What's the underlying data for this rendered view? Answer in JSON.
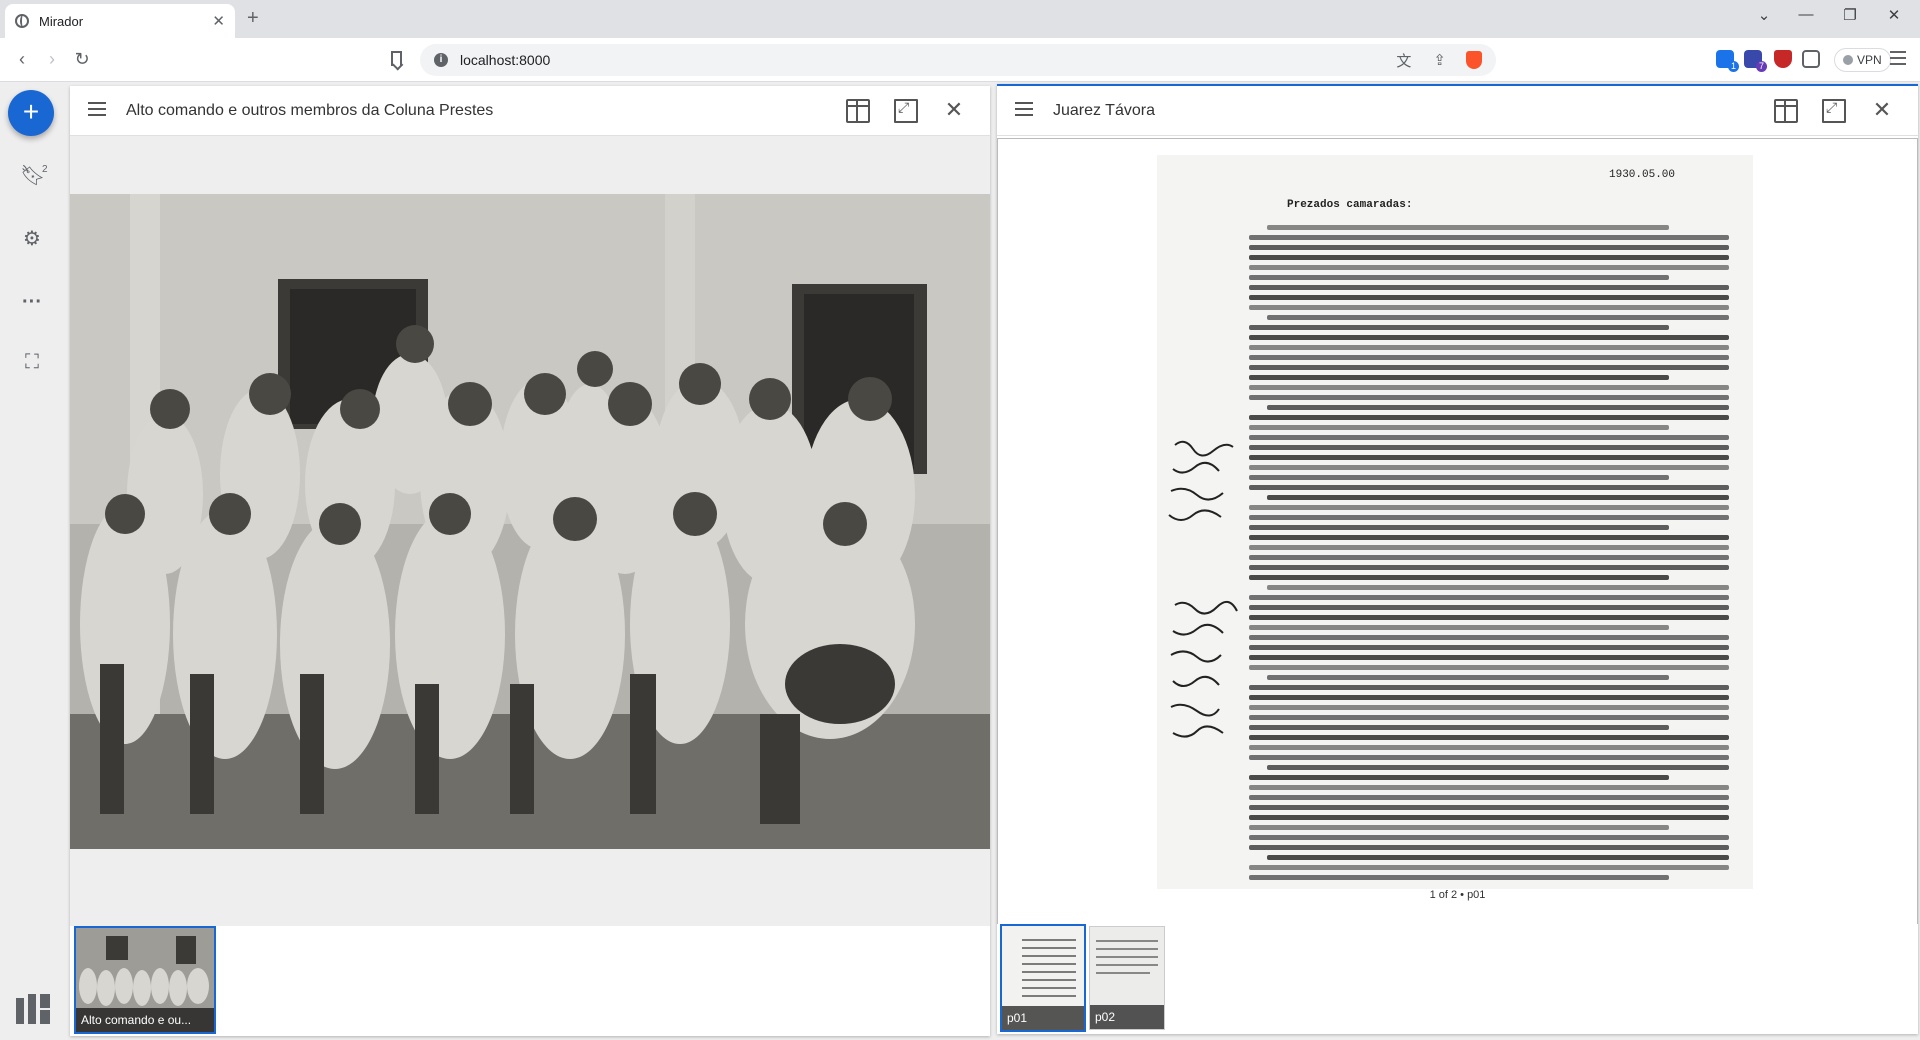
{
  "browser": {
    "tab_title": "Mirador",
    "tab_close": "✕",
    "new_tab": "+",
    "url": "localhost:8000",
    "vpn_label": "VPN",
    "ext_badge_1": "1",
    "ext_badge_2": "7"
  },
  "sidebar": {
    "add_label": "+",
    "catalog_count": "2"
  },
  "windows": [
    {
      "title": "Alto comando e outros membros da Coluna Prestes",
      "thumbnails": [
        {
          "label": "Alto comando e ou..."
        }
      ]
    },
    {
      "title": "Juarez Távora",
      "page_info": "1 of 2 • p01",
      "thumbnails": [
        {
          "label": "p01"
        },
        {
          "label": "p02"
        }
      ]
    }
  ],
  "document": {
    "salutation": "Prezados camaradas:",
    "date": "1930.05.00"
  },
  "colors": {
    "accent": "#1967d2",
    "chrome_bg": "#dfe1e5",
    "workspace_bg": "#eeeeee"
  },
  "icons": [
    "mirador-tab-icon",
    "back-icon",
    "forward-icon",
    "reload-icon",
    "bookmark-icon",
    "site-info-icon",
    "translate-icon",
    "share-icon",
    "brave-shield-icon",
    "menu-icon",
    "add-resource-icon",
    "catalog-icon",
    "settings-icon",
    "more-icon",
    "fullscreen-icon",
    "mirador-logo-icon",
    "window-menu-icon",
    "split-view-icon",
    "maximize-icon",
    "close-icon"
  ]
}
